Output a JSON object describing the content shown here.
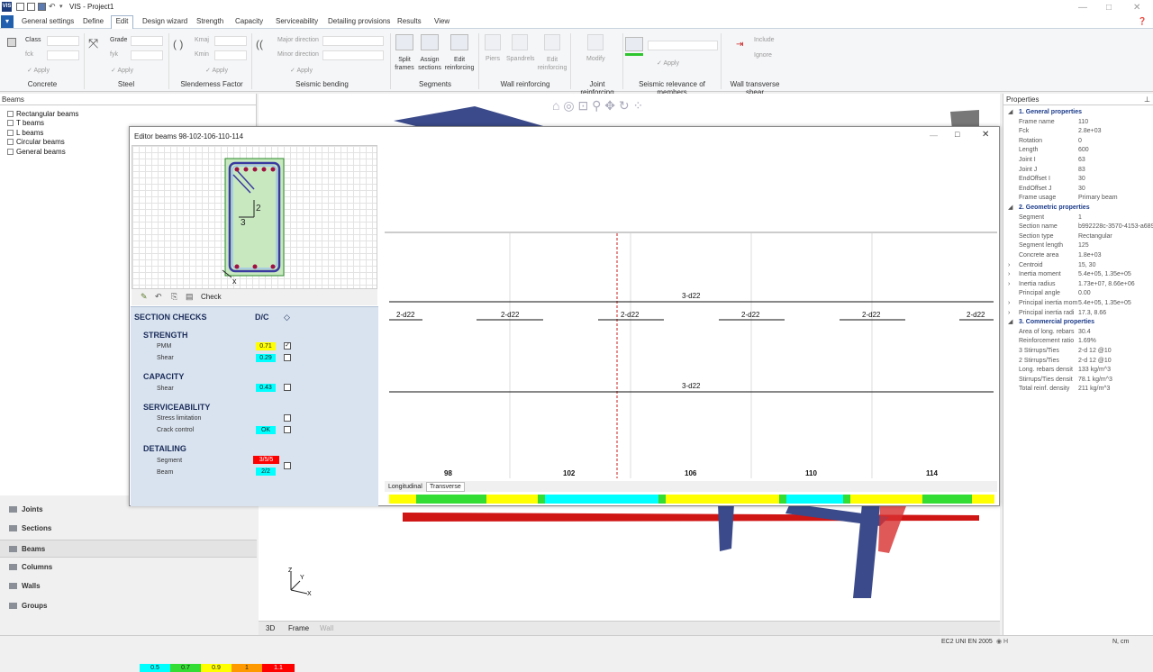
{
  "app": {
    "title": "VIS - Project1",
    "window_buttons": [
      "—",
      "□",
      "✕"
    ]
  },
  "menu": {
    "tabs": [
      "General settings",
      "Define",
      "Edit",
      "Design wizard",
      "Strength",
      "Capacity",
      "Serviceability",
      "Detailing provisions",
      "Results",
      "View"
    ],
    "active": "Edit"
  },
  "ribbon": {
    "concrete": {
      "class_label": "Class",
      "fck_label": "fck",
      "apply": "Apply",
      "group": "Concrete"
    },
    "steel": {
      "grade_label": "Grade",
      "fyk_label": "fyk",
      "apply": "Apply",
      "group": "Steel"
    },
    "slenderness": {
      "kmaj": "Kmaj",
      "kmin": "Kmin",
      "apply": "Apply",
      "group": "Slenderness Factor"
    },
    "seismic": {
      "major": "Major direction",
      "minor": "Minor direction",
      "apply": "Apply",
      "group": "Seismic bending"
    },
    "segments": {
      "split": "Split frames",
      "assign": "Assign sections",
      "edit": "Edit reinforcing",
      "group": "Segments"
    },
    "wall": {
      "piers": "Piers",
      "spandrels": "Spandrels",
      "edit": "Edit reinforcing",
      "group": "Wall reinforcing"
    },
    "joint": {
      "modify": "Modify",
      "group": "Joint reinforcing"
    },
    "relevance": {
      "apply": "Apply",
      "group": "Seismic relevance of members"
    },
    "transverse": {
      "include": "Include",
      "ignore": "Ignore",
      "group": "Wall transverse shear"
    }
  },
  "left_panel": {
    "title": "Beams",
    "tree": [
      "Rectangular beams",
      "T beams",
      "L beams",
      "Circular beams",
      "General beams"
    ]
  },
  "nav": {
    "items": [
      "Joints",
      "Sections",
      "Beams",
      "Columns",
      "Walls",
      "Groups"
    ],
    "selected": "Beams"
  },
  "editor": {
    "title": "Editor beams 98-102-106-110-114",
    "section_axes": {
      "a": "2",
      "b": "3",
      "x": "x"
    },
    "toolbar": {
      "check": "Check"
    },
    "checks": {
      "header": "SECTION CHECKS",
      "dc": "D/C",
      "strength": {
        "title": "STRENGTH",
        "pmm": "PMM",
        "pmm_val": "0.71",
        "pmm_checked": true,
        "shear": "Shear",
        "shear_val": "0.29"
      },
      "capacity": {
        "title": "CAPACITY",
        "shear": "Shear",
        "shear_val": "0.43"
      },
      "serviceability": {
        "title": "SERVICEABILITY",
        "stress": "Stress limitation",
        "crack": "Crack control",
        "crack_val": "OK"
      },
      "detailing": {
        "title": "DETAILING",
        "segment": "Segment",
        "segment_val": "3/5/5",
        "beam": "Beam",
        "beam_val": "2/2"
      },
      "legend": [
        "0.5",
        "0.7",
        "0.9",
        "1",
        "1.1"
      ]
    },
    "elevation": {
      "top_label": "3-d22",
      "bottom_label": "3-d22",
      "bar_labels": [
        "2-d22",
        "2-d22",
        "2-d22",
        "2-d22",
        "2-d22",
        "2-d22"
      ],
      "nodes": [
        "98",
        "102",
        "106",
        "110",
        "114"
      ]
    },
    "bottom_tabs": [
      "Longitudinal",
      "Transverse"
    ]
  },
  "view_tabs": [
    "3D",
    "Frame",
    "Wall"
  ],
  "properties": {
    "title": "Properties",
    "rows": [
      {
        "k": "1. General properties",
        "sec": true
      },
      {
        "k": "Frame name",
        "v": "110"
      },
      {
        "k": "Fck",
        "v": "2.8e+03"
      },
      {
        "k": "Rotation",
        "v": "0"
      },
      {
        "k": "Length",
        "v": "600"
      },
      {
        "k": "Joint I",
        "v": "63"
      },
      {
        "k": "Joint J",
        "v": "83"
      },
      {
        "k": "EndOffset I",
        "v": "30"
      },
      {
        "k": "EndOffset J",
        "v": "30"
      },
      {
        "k": "Frame usage",
        "v": "Primary beam"
      },
      {
        "k": "2. Geometric properties",
        "sec": true
      },
      {
        "k": "Segment",
        "v": "1"
      },
      {
        "k": "Section name",
        "v": "b992228c-3570-4153-a689"
      },
      {
        "k": "Section type",
        "v": "Rectangular"
      },
      {
        "k": "Segment length",
        "v": "125"
      },
      {
        "k": "Concrete area",
        "v": "1.8e+03"
      },
      {
        "k": "Centroid",
        "v": "15, 30",
        "exp": true
      },
      {
        "k": "Inertia moment",
        "v": "5.4e+05, 1.35e+05",
        "exp": true
      },
      {
        "k": "Inertia radius",
        "v": "1.73e+07, 8.66e+06",
        "exp": true
      },
      {
        "k": "Principal angle",
        "v": "0.00"
      },
      {
        "k": "Principal inertia mom",
        "v": "5.4e+05, 1.35e+05",
        "exp": true
      },
      {
        "k": "Principal inertia radi",
        "v": "17.3, 8.66",
        "exp": true
      },
      {
        "k": "3. Commercial properties",
        "sec": true
      },
      {
        "k": "Area of long. rebars",
        "v": "30.4"
      },
      {
        "k": "Reinforcement ratio",
        "v": "1.69%"
      },
      {
        "k": "3 Stirrups/Ties",
        "v": "2-d 12 @10"
      },
      {
        "k": "2 Stirrups/Ties",
        "v": "2-d 12 @10"
      },
      {
        "k": "Long. rebars densit",
        "v": "133 kg/m^3"
      },
      {
        "k": "Stirrups/Ties densit",
        "v": "78.1 kg/m^3"
      },
      {
        "k": "Total reinf. density",
        "v": "211 kg/m^3"
      }
    ]
  },
  "status": {
    "code": "EC2 UNI EN 2005",
    "units": "N, cm"
  },
  "colors": {
    "accent": "#1f5fae",
    "yellow": "#ffff00",
    "cyan": "#00ffff",
    "green": "#33dd33",
    "orange": "#ff9900",
    "red": "#ff0000"
  }
}
